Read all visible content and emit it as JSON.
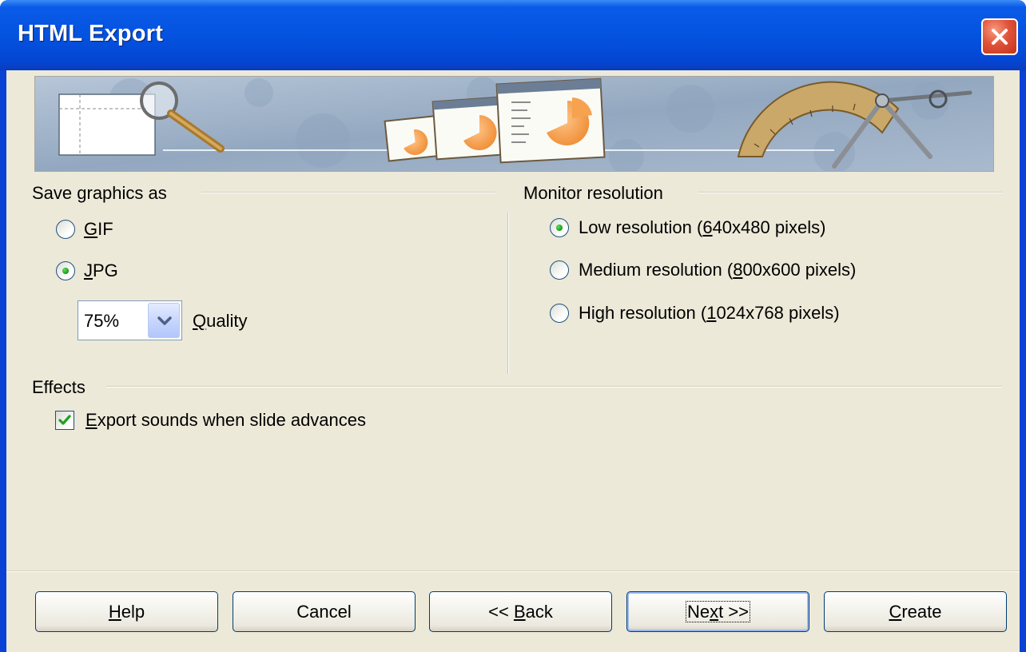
{
  "window": {
    "title": "HTML Export"
  },
  "save_graphics": {
    "heading": "Save graphics as",
    "options": [
      {
        "label": "GIF",
        "mnemonic": "G",
        "rest": "IF",
        "selected": false
      },
      {
        "label": "JPG",
        "mnemonic": "J",
        "rest": "PG",
        "selected": true
      }
    ],
    "quality": {
      "value": "75%",
      "label": "Quality",
      "mnemonic": "Q",
      "rest": "uality"
    }
  },
  "monitor_resolution": {
    "heading": "Monitor resolution",
    "options": [
      {
        "label": "Low resolution (640x480 pixels)",
        "pre": "Low resolution (",
        "mnemonic": "6",
        "post": "40x480 pixels)",
        "selected": true
      },
      {
        "label": "Medium resolution (800x600 pixels)",
        "pre": "Medium resolution (",
        "mnemonic": "8",
        "post": "00x600 pixels)",
        "selected": false
      },
      {
        "label": "High resolution (1024x768 pixels)",
        "pre": "High resolution (",
        "mnemonic": "1",
        "post": "024x768 pixels)",
        "selected": false
      }
    ]
  },
  "effects": {
    "heading": "Effects",
    "export_sounds": {
      "label": "Export sounds when slide advances",
      "mnemonic": "E",
      "rest": "xport sounds when slide advances",
      "checked": true
    }
  },
  "buttons": {
    "help": {
      "label": "Help",
      "mnemonic": "H",
      "rest": "elp"
    },
    "cancel": {
      "label": "Cancel"
    },
    "back": {
      "label": "<< Back",
      "pre": "<< ",
      "mnemonic": "B",
      "rest": "ack"
    },
    "next": {
      "label": "Next >>",
      "pre": "Ne",
      "mnemonic": "x",
      "rest": "t >>"
    },
    "create": {
      "label": "Create",
      "mnemonic": "C",
      "rest": "reate"
    }
  },
  "colors": {
    "titlebar": "#0453e0",
    "dialog_bg": "#ece9d8",
    "radio_dot": "#21a121",
    "checkmark": "#21a121",
    "button_border": "#003c74",
    "close_button": "#e0533a"
  },
  "icons": [
    "close-icon",
    "banner-illustration",
    "chevron-down-icon",
    "checkmark-icon"
  ]
}
